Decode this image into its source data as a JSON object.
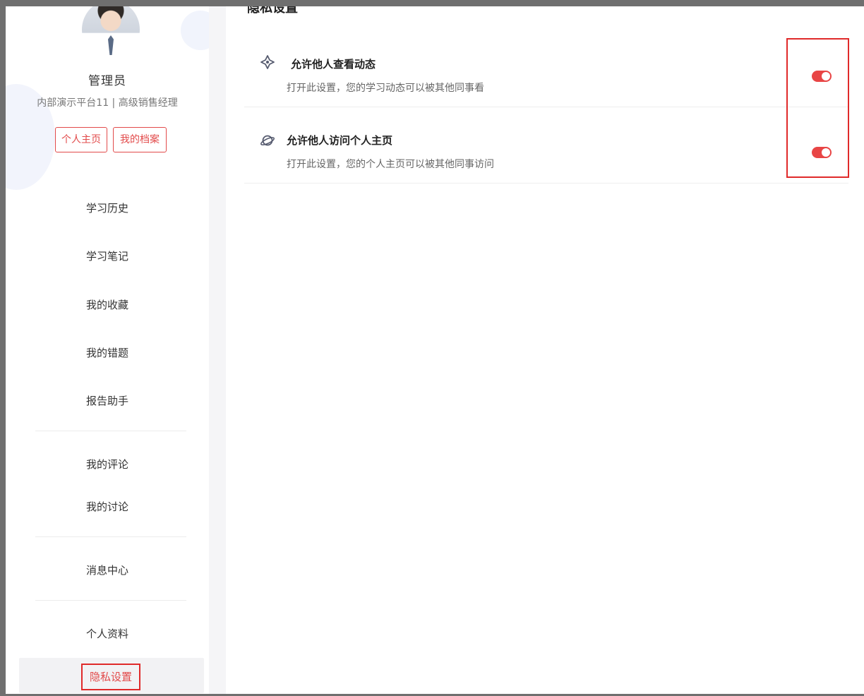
{
  "user": {
    "name": "管理员",
    "subtitle": "内部演示平台11 | 高级销售经理",
    "buttons": {
      "profile": "个人主页",
      "archive": "我的档案"
    }
  },
  "sidebar": {
    "items": [
      {
        "label": "学习历史"
      },
      {
        "label": "学习笔记"
      },
      {
        "label": "我的收藏"
      },
      {
        "label": "我的错题"
      },
      {
        "label": "报告助手"
      },
      {
        "label": "我的评论"
      },
      {
        "label": "我的讨论"
      },
      {
        "label": "消息中心"
      },
      {
        "label": "个人资料"
      },
      {
        "label": "隐私设置",
        "active": true
      }
    ]
  },
  "main": {
    "section_title": "隐私设置",
    "settings": [
      {
        "title": "允许他人查看动态",
        "description": "打开此设置，您的学习动态可以被其他同事看",
        "enabled": true,
        "icon": "diamond-star-icon"
      },
      {
        "title": "允许他人访问个人主页",
        "description": "打开此设置，您的个人主页可以被其他同事访问",
        "enabled": true,
        "icon": "planet-icon"
      }
    ]
  },
  "colors": {
    "accent": "#e24a4a",
    "toggle_on": "#e84545",
    "highlight": "#e02a2a"
  }
}
